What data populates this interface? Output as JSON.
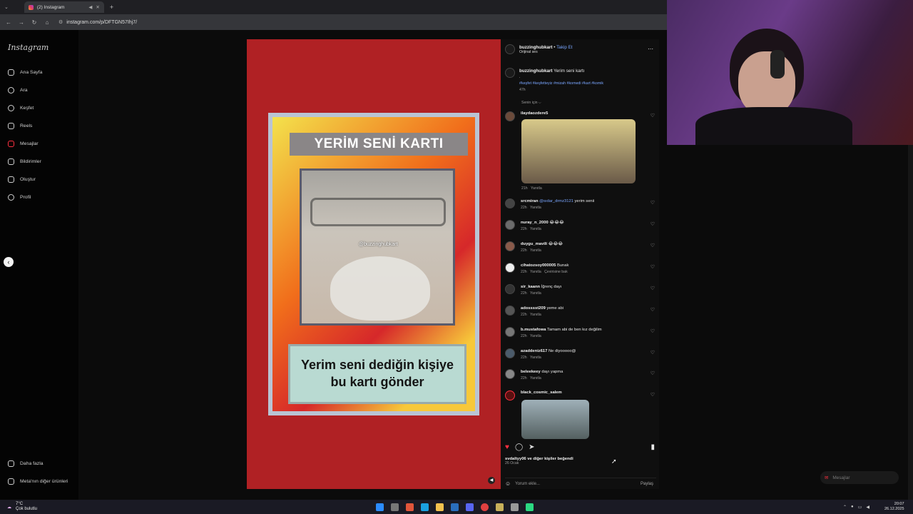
{
  "browser": {
    "tab_title": "(2) Instagram",
    "url": "instagram.com/p/DFTGN57Ihj7/"
  },
  "sidebar": {
    "logo": "Instagram",
    "items": [
      {
        "label": "Ana Sayfa"
      },
      {
        "label": "Ara"
      },
      {
        "label": "Keşfet"
      },
      {
        "label": "Reels"
      },
      {
        "label": "Mesajlar"
      },
      {
        "label": "Bildirimler"
      },
      {
        "label": "Oluştur"
      },
      {
        "label": "Profil"
      }
    ],
    "more": "Daha fazla",
    "meta": "Meta'nın diğer ürünleri"
  },
  "card": {
    "title": "YERİM SENİ KARTI",
    "watermark": "@buzzinghubkart",
    "caption_line1": "Yerim seni dediğin kişiye",
    "caption_line2": "bu kartı gönder"
  },
  "post": {
    "username": "buzzinghubkart",
    "follow": "Takip Et",
    "audio": "Orijinal ses",
    "caption_user": "buzzinghubkart",
    "caption_text": "Yerim seni kartı",
    "caption_dot": ".",
    "hashtags": "#keşfet #keşfetteyiz #mizah #komedi #kart #komik",
    "caption_time": "47h",
    "sort": "Senin için ⌵",
    "comments": [
      {
        "user": "ilaydaozdere5",
        "text": "",
        "time": "21h",
        "reply": "Yanıtla"
      },
      {
        "user": "srcmiran",
        "mention": "@sıdar_drmz3121",
        "text": "yerim senii",
        "time": "22h",
        "reply": "Yanıtla"
      },
      {
        "user": "nuray_n_2000",
        "text": "😂😂😂",
        "time": "22h",
        "reply": "Yanıtla"
      },
      {
        "user": "duygu_mavili",
        "text": "😂😂😂",
        "time": "22h",
        "reply": "Yanıtla"
      },
      {
        "user": "cihatozsoy000005",
        "text": "Bunak",
        "time": "22h",
        "reply": "Yanıtla",
        "translate": "Çevirisine bak"
      },
      {
        "user": "sir_kaann",
        "text": "İğrenç dayı",
        "time": "22h",
        "reply": "Yanıtla"
      },
      {
        "user": "adosssst209",
        "text": "yeme abi",
        "time": "22h",
        "reply": "Yanıtla"
      },
      {
        "user": "b.mustafowa",
        "text": "Tamam abi de ben kız değilim",
        "time": "22h",
        "reply": "Yanıtla"
      },
      {
        "user": "azaddeniz617",
        "text": "Ne diyooooo@",
        "time": "22h",
        "reply": "Yanıtla"
      },
      {
        "user": "beleekeey",
        "text": "dayı yapma",
        "time": "22h",
        "reply": "Yanıtla"
      },
      {
        "user": "black_cosmic_salem",
        "text": "",
        "time": "",
        "reply": ""
      }
    ],
    "likes": "svdaltyy06 ve diğer kişiler beğendi",
    "date": "26 Ocak",
    "comment_placeholder": "Yorum ekle...",
    "share": "Paylaş"
  },
  "floating": {
    "messages": "Mesajlar"
  },
  "taskbar": {
    "weather_temp": "7°C",
    "weather_text": "Çok bulutlu",
    "time": "20:07",
    "date": "26.12.2025"
  },
  "colors": {
    "post_bg": "#b02124",
    "like": "#ff3040",
    "link": "#7aa6ff"
  }
}
